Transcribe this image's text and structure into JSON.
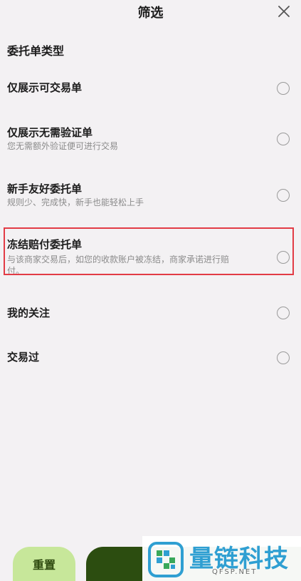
{
  "header": {
    "title": "筛选",
    "close_icon": "close-icon"
  },
  "section": {
    "title": "委托单类型"
  },
  "options": [
    {
      "title": "仅展示可交易单",
      "desc": "",
      "selected": false
    },
    {
      "title": "仅展示无需验证单",
      "desc": "您无需额外验证便可进行交易",
      "selected": false
    },
    {
      "title": "新手友好委托单",
      "desc": "规则少、完成快，新手也能轻松上手",
      "selected": false
    },
    {
      "title": "冻结赔付委托单",
      "desc": "与该商家交易后，如您的收款账户被冻结，商家承诺进行赔付。",
      "selected": false
    },
    {
      "title": "我的关注",
      "desc": "",
      "selected": false
    },
    {
      "title": "交易过",
      "desc": "",
      "selected": false
    }
  ],
  "footer": {
    "reset_label": "重置"
  },
  "watermark": {
    "text": "量链科技",
    "sub": "QFSP.NET"
  },
  "colors": {
    "background": "#f3f1f3",
    "accent_light": "#c7e79a",
    "accent_dark": "#2c4d10",
    "highlight": "#e23b45",
    "watermark": "#2f9fd2"
  }
}
